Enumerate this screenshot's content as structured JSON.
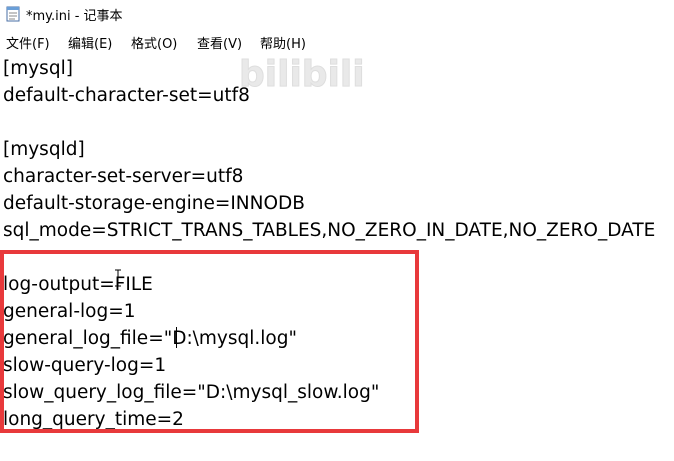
{
  "window": {
    "title": "*my.ini - 记事本"
  },
  "menu": {
    "items": [
      {
        "label": "文件(F)"
      },
      {
        "label": "编辑(E)"
      },
      {
        "label": "格式(O)"
      },
      {
        "label": "查看(V)"
      },
      {
        "label": "帮助(H)"
      }
    ]
  },
  "watermark": {
    "text": "bilibili"
  },
  "editor": {
    "lines": [
      "[mysql]",
      "default-character-set=utf8",
      "",
      "[mysqld]",
      "character-set-server=utf8",
      "default-storage-engine=INNODB",
      "sql_mode=STRICT_TRANS_TABLES,NO_ZERO_IN_DATE,NO_ZERO_DATE",
      "",
      "log-output=FILE",
      "general-log=1",
      "general_log_file=\"D:\\mysql.log\"",
      "slow-query-log=1",
      "slow_query_log_file=\"D:\\mysql_slow.log\"",
      "long_query_time=2"
    ]
  },
  "colors": {
    "highlight_border": "#e8393b",
    "text": "#000000",
    "background": "#ffffff"
  }
}
